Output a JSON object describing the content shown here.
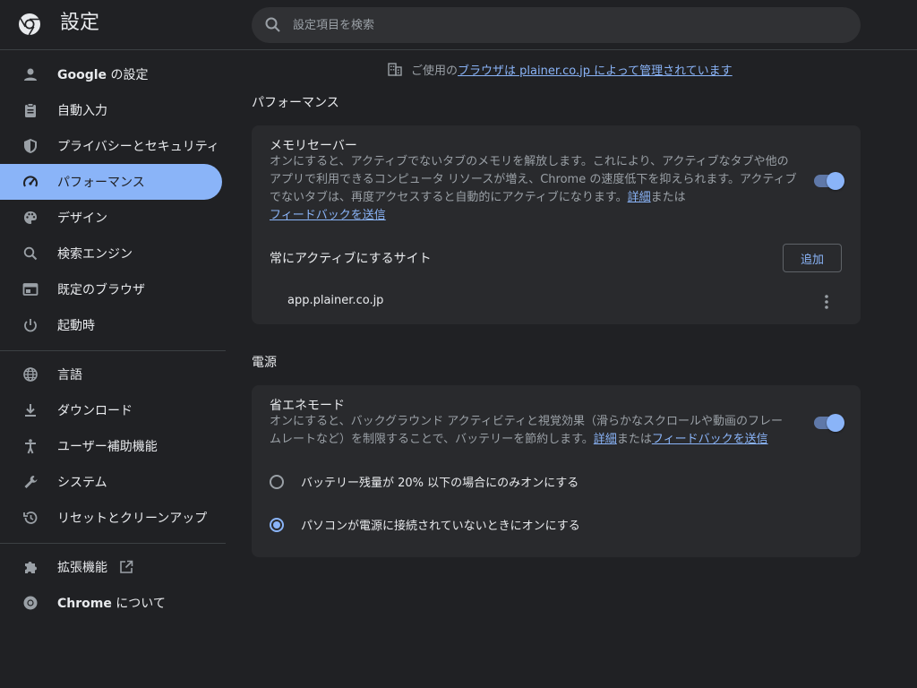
{
  "app": {
    "title": "設定"
  },
  "search": {
    "placeholder": "設定項目を検索"
  },
  "sidebar": {
    "items": [
      {
        "label_bold": "Google",
        "label": " の設定",
        "icon": "person-icon"
      },
      {
        "label": "自動入力",
        "icon": "clipboard-icon"
      },
      {
        "label": "プライバシーとセキュリティ",
        "icon": "shield-icon"
      },
      {
        "label": "パフォーマンス",
        "icon": "speedometer-icon",
        "active": true
      },
      {
        "label": "デザイン",
        "icon": "palette-icon"
      },
      {
        "label": "検索エンジン",
        "icon": "search-icon"
      },
      {
        "label": "既定のブラウザ",
        "icon": "browser-icon"
      },
      {
        "label": "起動時",
        "icon": "power-icon"
      },
      {
        "label": "言語",
        "icon": "globe-icon"
      },
      {
        "label": "ダウンロード",
        "icon": "download-icon"
      },
      {
        "label": "ユーザー補助機能",
        "icon": "accessibility-icon"
      },
      {
        "label": "システム",
        "icon": "wrench-icon"
      },
      {
        "label": "リセットとクリーンアップ",
        "icon": "history-icon"
      },
      {
        "label": "拡張機能",
        "icon": "puzzle-icon"
      },
      {
        "label_bold": "Chrome",
        "label": " について",
        "icon": "chrome-icon"
      }
    ]
  },
  "managed": {
    "prefix": "ご使用の",
    "link": "ブラウザは plainer.co.jp によって管理されています"
  },
  "performance": {
    "title": "パフォーマンス",
    "memory_saver": {
      "title": "メモリセーバー",
      "desc_line1": "オンにすると、アクティブでないタブのメモリを解放します。これにより、アクティブなタブや他の",
      "desc_line2": "アプリで利用できるコンピュータ リソースが増え、Chrome の速度低下を抑えられます。アクティブ",
      "desc_line3": "でないタブは、再度アクセスすると自動的にアクティブになります。",
      "details_link": "詳細",
      "or_text": "または",
      "feedback_link": "フィードバックを送信",
      "enabled": true
    },
    "always_active": {
      "title": "常にアクティブにするサイト",
      "add_label": "追加",
      "sites": [
        "app.plainer.co.jp"
      ]
    }
  },
  "power": {
    "title": "電源",
    "energy_saver": {
      "title": "省エネモード",
      "desc_line1": "オンにすると、バックグラウンド アクティビティと視覚効果（滑らかなスクロールや動画のフレー",
      "desc_line2": "ムレートなど）を制限することで、バッテリーを節約します。",
      "details_link": "詳細",
      "or_text": "または",
      "feedback_link": "フィードバックを送信",
      "enabled": true
    },
    "options": [
      {
        "label": "バッテリー残量が 20% 以下の場合にのみオンにする",
        "checked": false
      },
      {
        "label": "パソコンが電源に接続されていないときにオンにする",
        "checked": true
      }
    ]
  },
  "colors": {
    "accent": "#8ab4f8",
    "background": "#202124",
    "card": "#292a2d"
  }
}
